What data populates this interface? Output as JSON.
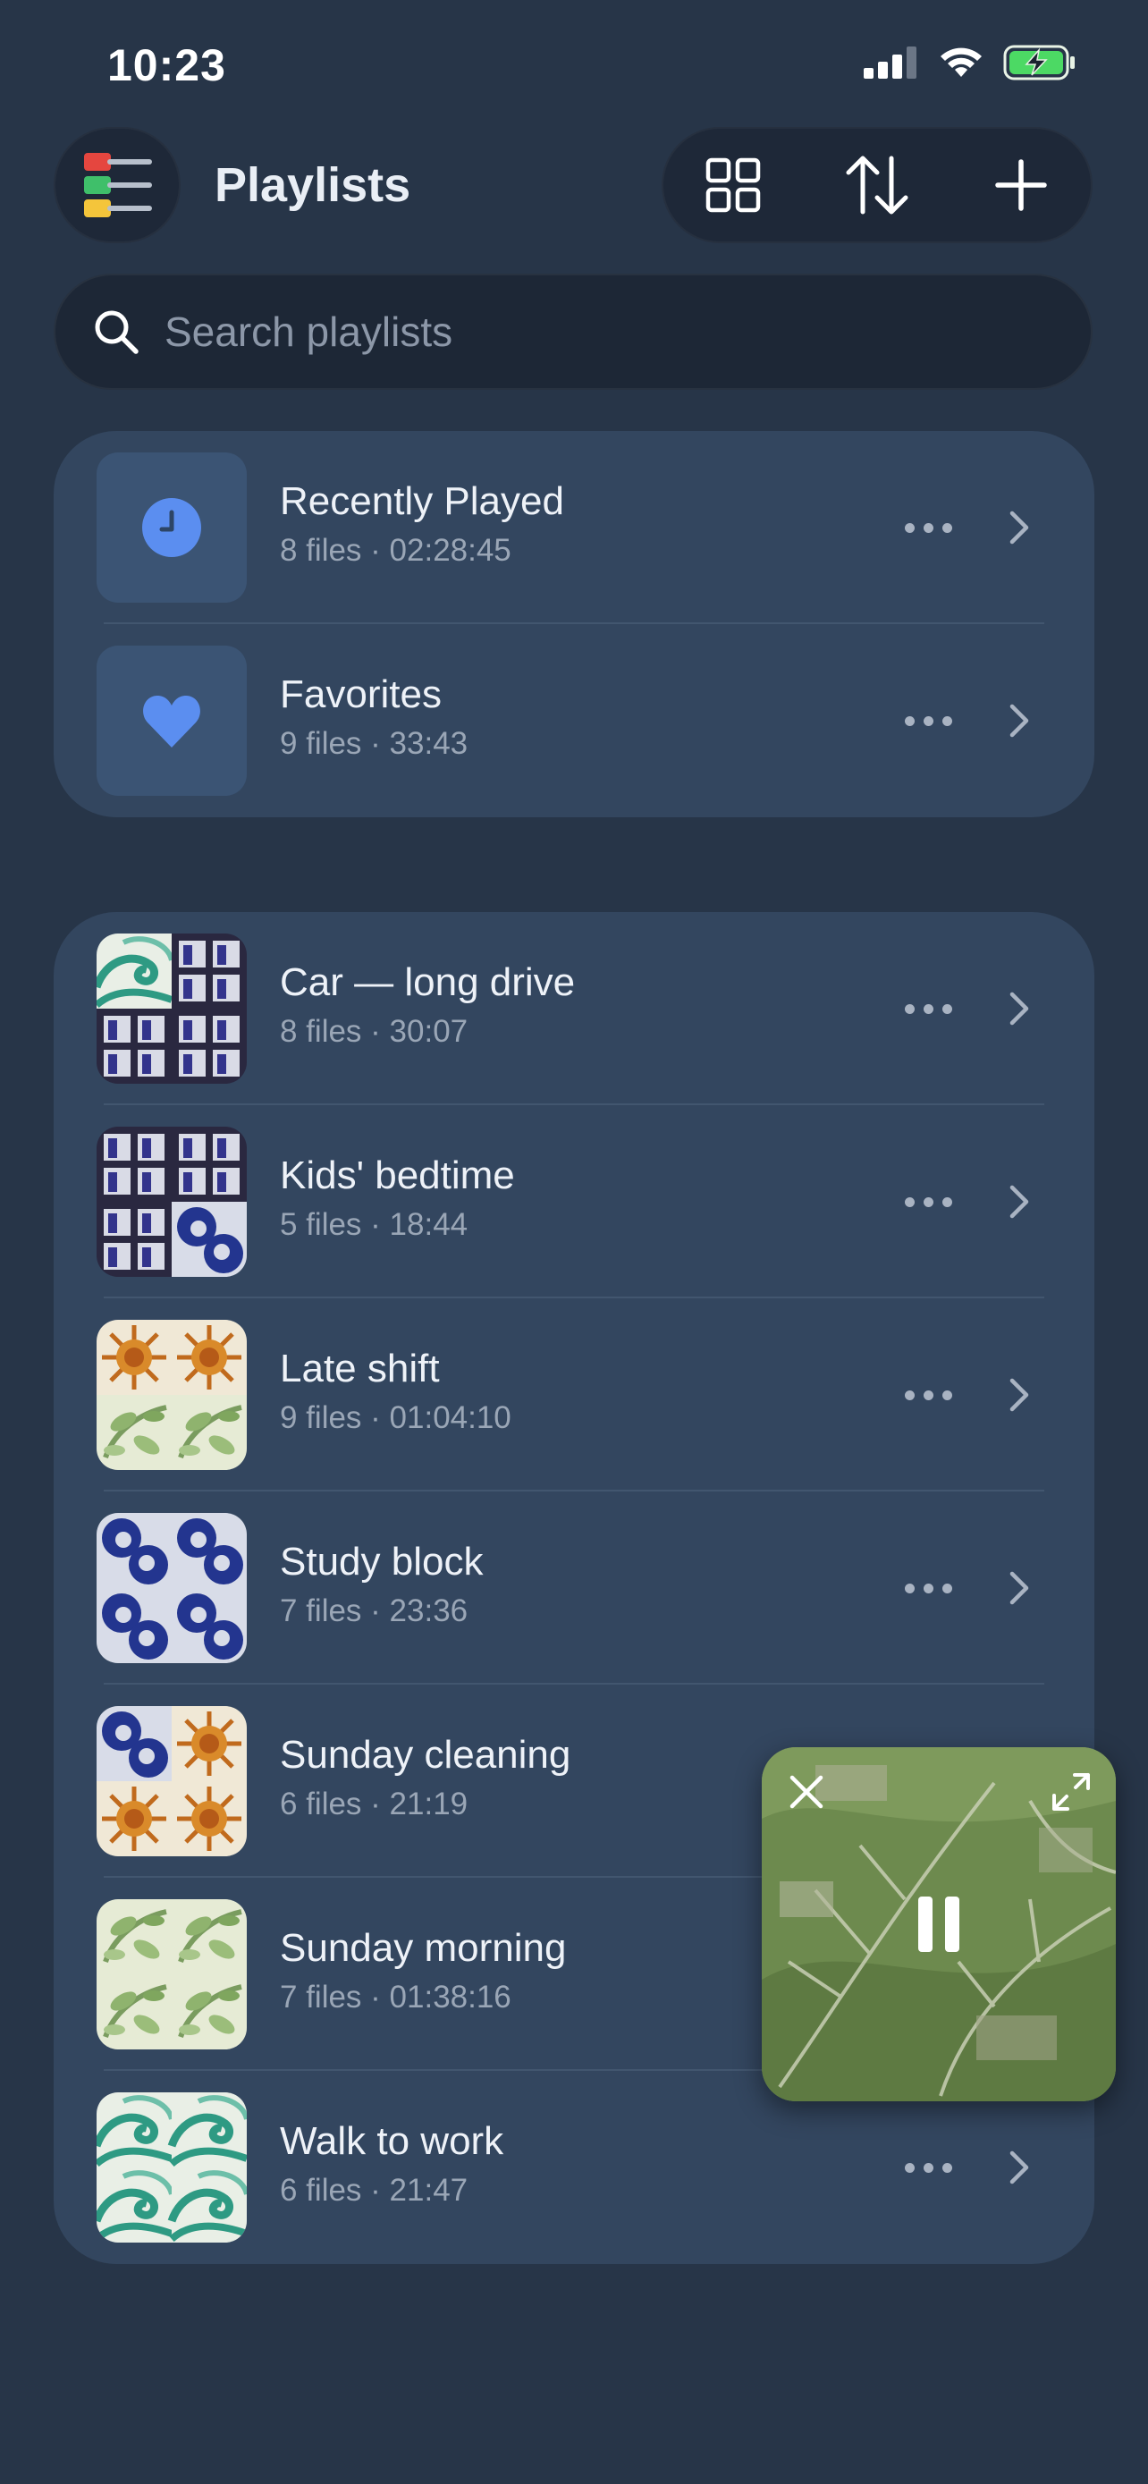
{
  "status_bar": {
    "time": "10:23"
  },
  "header": {
    "title": "Playlists"
  },
  "search": {
    "placeholder": "Search playlists"
  },
  "system_playlists": [
    {
      "name": "Recently Played",
      "meta": "8 files · 02:28:45",
      "icon": "clock-icon"
    },
    {
      "name": "Favorites",
      "meta": "9 files · 33:43",
      "icon": "heart-icon"
    }
  ],
  "user_playlists": [
    {
      "name": "Car — long drive",
      "meta": "8 files · 30:07"
    },
    {
      "name": "Kids' bedtime",
      "meta": "5 files · 18:44"
    },
    {
      "name": "Late shift",
      "meta": "9 files · 01:04:10"
    },
    {
      "name": "Study block",
      "meta": "7 files · 23:36"
    },
    {
      "name": "Sunday cleaning",
      "meta": "6 files · 21:19"
    },
    {
      "name": "Sunday morning",
      "meta": "7 files · 01:38:16"
    },
    {
      "name": "Walk to work",
      "meta": "6 files · 21:47"
    }
  ],
  "mini_player": {
    "state": "playing"
  },
  "colors": {
    "accent": "#5b8ef0",
    "background": "#273548",
    "card": "#33465f"
  }
}
